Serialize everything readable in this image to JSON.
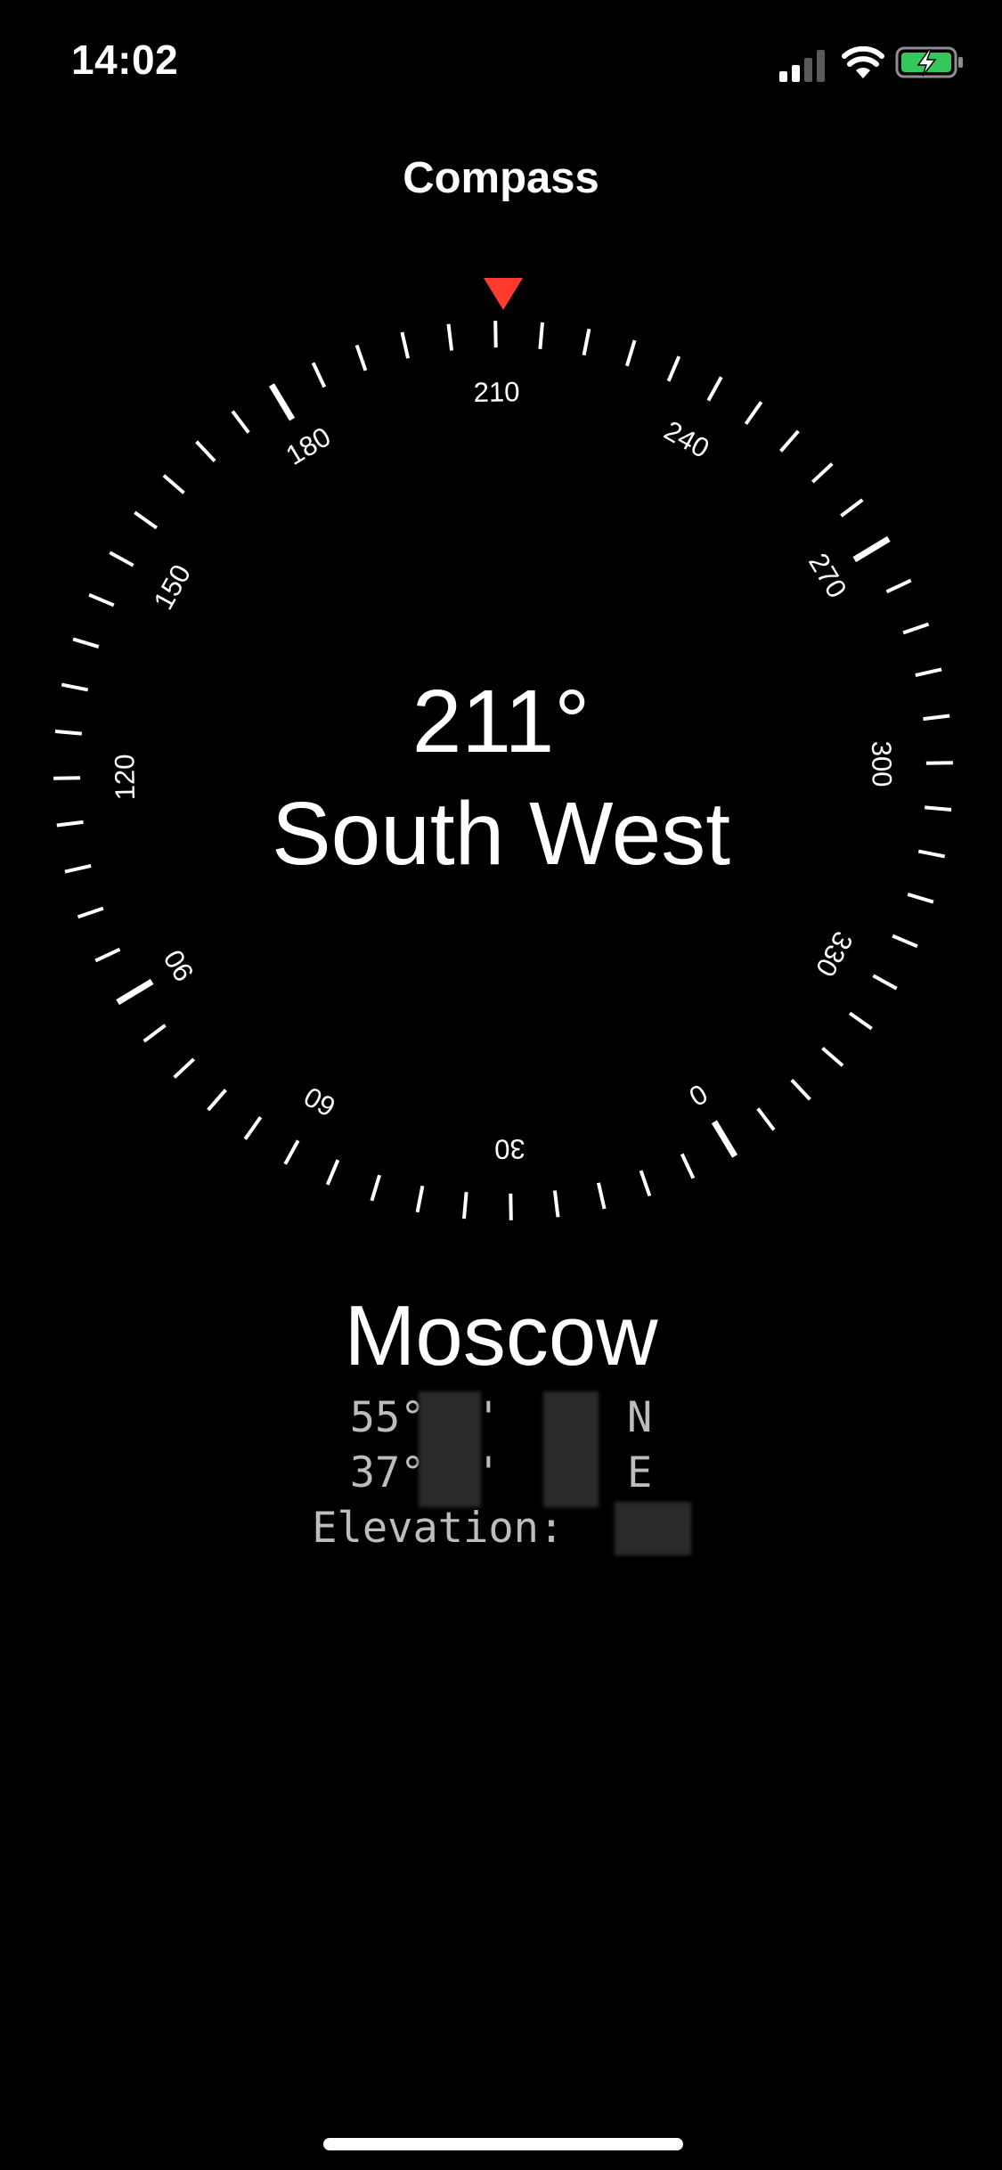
{
  "status_bar": {
    "time": "14:02",
    "icons": [
      "cellular-signal-icon",
      "wifi-icon",
      "battery-charging-icon"
    ],
    "battery_color": "#34c759"
  },
  "nav": {
    "title": "Compass"
  },
  "compass": {
    "heading_degrees": "211°",
    "heading_direction": "South West",
    "marker_color": "#ff3b30",
    "dial_labels": [
      "0",
      "30",
      "60",
      "90",
      "120",
      "150",
      "180",
      "210",
      "240",
      "270",
      "300",
      "330"
    ]
  },
  "location": {
    "city": "Moscow",
    "latitude": "55°  '  '' N",
    "longitude": "37°  '  '' E",
    "elevation": "Elevation:    m"
  }
}
